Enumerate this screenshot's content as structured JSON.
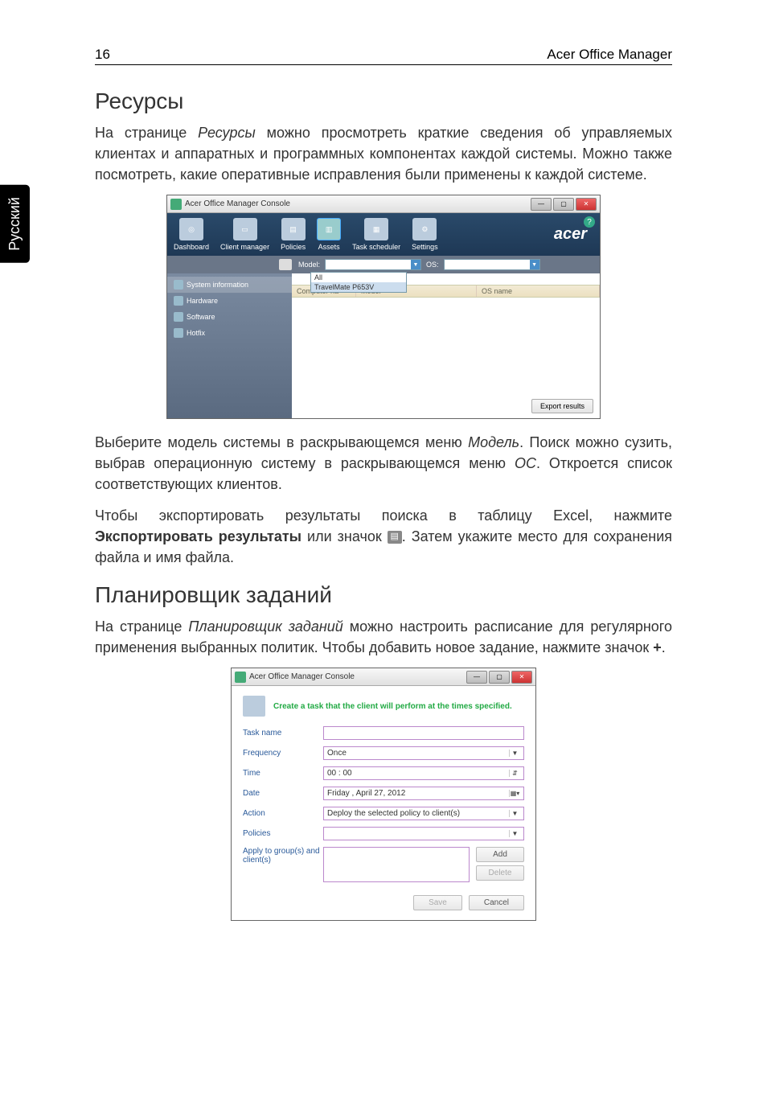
{
  "header": {
    "page_number": "16",
    "title": "Acer Office Manager"
  },
  "side_tab": "Русский",
  "section1": {
    "heading": "Ресурсы",
    "para1_a": "На странице ",
    "para1_italic": "Ресурсы",
    "para1_b": " можно просмотреть краткие сведения об управляемых клиентах и аппаратных и программных компонентах каждой системы. Можно также посмотреть, какие оперативные исправления были применены к каждой системе.",
    "para2_a": "Выберите модель системы в раскрывающемся меню ",
    "para2_italic1": "Модель",
    "para2_b": ". Поиск можно сузить, выбрав операционную систему в раскрывающемся меню ",
    "para2_italic2": "ОС",
    "para2_c": ". Откроется список соответствующих клиентов.",
    "para3_a": "Чтобы экспортировать результаты поиска в таблицу Excel, нажмите ",
    "para3_bold": "Экспортировать результаты",
    "para3_b": " или значок ",
    "para3_c": ". Затем укажите место для сохранения файла и имя файла."
  },
  "section2": {
    "heading": "Планировщик заданий",
    "para1_a": "На странице ",
    "para1_italic": "Планировщик заданий",
    "para1_b": " можно настроить расписание для регулярного применения выбранных политик. Чтобы добавить новое задание, нажмите значок ",
    "para1_bold": "+",
    "para1_c": "."
  },
  "screenshot1": {
    "window_title": "Acer Office Manager Console",
    "brand": "acer",
    "nav": {
      "dashboard": "Dashboard",
      "client_manager": "Client manager",
      "policies": "Policies",
      "assets": "Assets",
      "task_scheduler": "Task scheduler",
      "settings": "Settings"
    },
    "filter": {
      "model_label": "Model:",
      "os_label": "OS:",
      "dropdown_all": "All",
      "dropdown_item": "TravelMate P653V"
    },
    "sidebar": {
      "system_information": "System information",
      "hardware": "Hardware",
      "software": "Software",
      "hotfix": "Hotfix"
    },
    "grid": {
      "col1": "Computer na",
      "col2": "Model",
      "col3": "OS name"
    },
    "export_button": "Export results"
  },
  "screenshot2": {
    "window_title": "Acer Office Manager Console",
    "header_text": "Create a task that the client will perform at the times specified.",
    "labels": {
      "task_name": "Task name",
      "frequency": "Frequency",
      "time": "Time",
      "date": "Date",
      "action": "Action",
      "policies": "Policies",
      "apply_to": "Apply to group(s) and client(s)"
    },
    "values": {
      "frequency": "Once",
      "time": "00 : 00",
      "date": "Friday   ,    April    27, 2012",
      "action": "Deploy the selected policy to client(s)"
    },
    "buttons": {
      "add": "Add",
      "delete": "Delete",
      "save": "Save",
      "cancel": "Cancel"
    }
  }
}
